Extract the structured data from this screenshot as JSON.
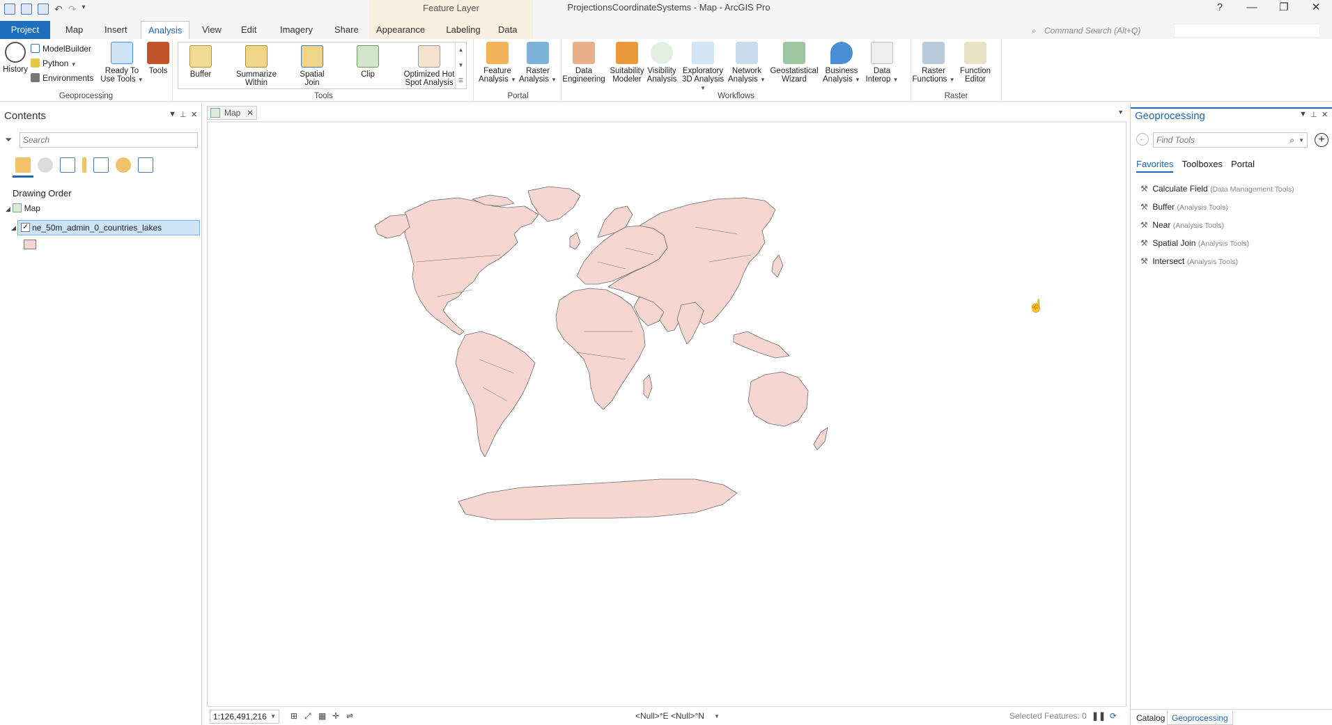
{
  "window": {
    "title": "ProjectionsCoordinateSystems - Map - ArcGIS Pro",
    "help": "?",
    "minimize": "—",
    "restore": "❐",
    "close": "✕"
  },
  "context_group": "Feature Layer",
  "tabs": [
    "Project",
    "Map",
    "Insert",
    "Analysis",
    "View",
    "Edit",
    "Imagery",
    "Share",
    "Appearance",
    "Labeling",
    "Data"
  ],
  "command_search": {
    "placeholder": "Command Search (Alt+Q)"
  },
  "ribbon": {
    "geoprocessing": {
      "label": "Geoprocessing",
      "history": "History",
      "modelbuilder": "ModelBuilder",
      "python": "Python",
      "environments": "Environments",
      "ready_line1": "Ready To",
      "ready_line2": "Use Tools",
      "tools": "Tools"
    },
    "tools": {
      "label": "Tools",
      "items": [
        {
          "l1": "Buffer",
          "l2": ""
        },
        {
          "l1": "Summarize",
          "l2": "Within"
        },
        {
          "l1": "Spatial",
          "l2": "Join"
        },
        {
          "l1": "Clip",
          "l2": ""
        },
        {
          "l1": "Optimized Hot",
          "l2": "Spot Analysis"
        }
      ]
    },
    "portal": {
      "label": "Portal",
      "items": [
        {
          "l1": "Feature",
          "l2": "Analysis"
        },
        {
          "l1": "Raster",
          "l2": "Analysis"
        }
      ]
    },
    "workflows": {
      "label": "Workflows",
      "items": [
        {
          "l1": "Data",
          "l2": "Engineering"
        },
        {
          "l1": "Suitability",
          "l2": "Modeler"
        },
        {
          "l1": "Visibility",
          "l2": "Analysis"
        },
        {
          "l1": "Exploratory",
          "l2": "3D Analysis"
        },
        {
          "l1": "Network",
          "l2": "Analysis"
        },
        {
          "l1": "Geostatistical",
          "l2": "Wizard"
        },
        {
          "l1": "Business",
          "l2": "Analysis"
        },
        {
          "l1": "Data",
          "l2": "Interop"
        }
      ]
    },
    "raster": {
      "label": "Raster",
      "items": [
        {
          "l1": "Raster",
          "l2": "Functions"
        },
        {
          "l1": "Function",
          "l2": "Editor"
        }
      ]
    }
  },
  "contents": {
    "title": "Contents",
    "search_placeholder": "Search",
    "drawing_order": "Drawing Order",
    "map_node": "Map",
    "layer_name": "ne_50m_admin_0_countries_lakes",
    "layer_fill": "#f5d6d0"
  },
  "map_view": {
    "tab_label": "Map",
    "scale": "1:126,491,216",
    "coordinates": "<Null>°E <Null>°N",
    "selected_features": "Selected Features: 0",
    "land_color": "#f5d6d0",
    "border_color": "#6b6b6b"
  },
  "geoprocessing_pane": {
    "title": "Geoprocessing",
    "find_placeholder": "Find Tools",
    "subtabs": [
      "Favorites",
      "Toolboxes",
      "Portal"
    ],
    "favorites": [
      {
        "name": "Calculate Field",
        "toolbox": "(Data Management Tools)"
      },
      {
        "name": "Buffer",
        "toolbox": "(Analysis Tools)"
      },
      {
        "name": "Near",
        "toolbox": "(Analysis Tools)"
      },
      {
        "name": "Spatial Join",
        "toolbox": "(Analysis Tools)"
      },
      {
        "name": "Intersect",
        "toolbox": "(Analysis Tools)"
      }
    ],
    "bottom_tabs": [
      "Catalog",
      "Geoprocessing"
    ]
  }
}
